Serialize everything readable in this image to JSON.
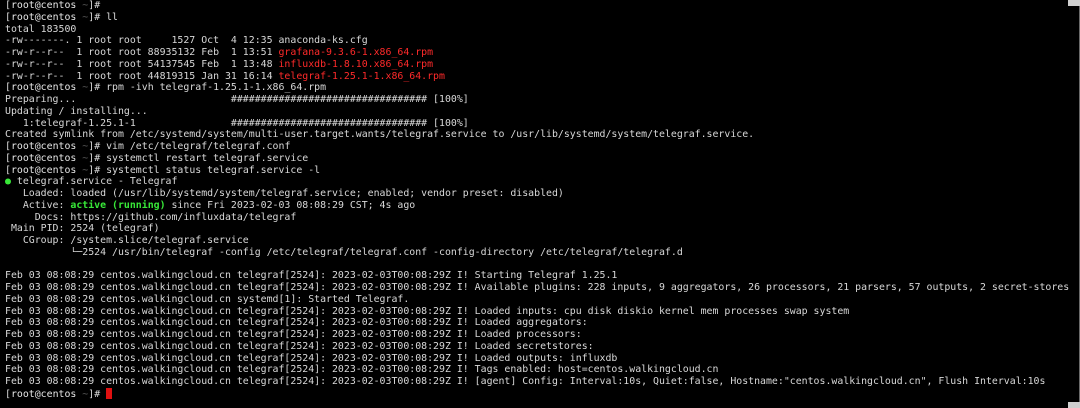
{
  "prompt": {
    "open": "[",
    "user_host": "root@centos",
    "path": " ~",
    "close": "]#"
  },
  "lines": [
    {
      "kind": "prompt",
      "cmd": ""
    },
    {
      "kind": "prompt",
      "cmd": " ll"
    },
    {
      "kind": "text",
      "text": "total 183500"
    },
    {
      "kind": "file",
      "meta": "-rw-------. 1 root root     1527 Oct  4 12:35 ",
      "name": "anaconda-ks.cfg",
      "color": "plain"
    },
    {
      "kind": "file",
      "meta": "-rw-r--r--  1 root root 88935132 Feb  1 13:51 ",
      "name": "grafana-9.3.6-1.x86_64.rpm",
      "color": "red"
    },
    {
      "kind": "file",
      "meta": "-rw-r--r--  1 root root 54137545 Feb  1 13:48 ",
      "name": "influxdb-1.8.10.x86_64.rpm",
      "color": "red"
    },
    {
      "kind": "file",
      "meta": "-rw-r--r--  1 root root 44819315 Jan 31 16:14 ",
      "name": "telegraf-1.25.1-1.x86_64.rpm",
      "color": "red"
    },
    {
      "kind": "prompt",
      "cmd": " rpm -ivh telegraf-1.25.1-1.x86_64.rpm"
    },
    {
      "kind": "text",
      "text": "Preparing...                          ################################# [100%]"
    },
    {
      "kind": "text",
      "text": "Updating / installing..."
    },
    {
      "kind": "text",
      "text": "   1:telegraf-1.25.1-1                ################################# [100%]"
    },
    {
      "kind": "text",
      "text": "Created symlink from /etc/systemd/system/multi-user.target.wants/telegraf.service to /usr/lib/systemd/system/telegraf.service."
    },
    {
      "kind": "prompt",
      "cmd": " vim /etc/telegraf/telegraf.conf"
    },
    {
      "kind": "prompt",
      "cmd": " systemctl restart telegraf.service"
    },
    {
      "kind": "prompt",
      "cmd": " systemctl status telegraf.service -l"
    },
    {
      "kind": "service",
      "bullet": "●",
      "text": " telegraf.service - Telegraf"
    },
    {
      "kind": "text",
      "text": "   Loaded: loaded (/usr/lib/systemd/system/telegraf.service; enabled; vendor preset: disabled)"
    },
    {
      "kind": "active",
      "label": "   Active: ",
      "status": "active (running)",
      "rest": " since Fri 2023-02-03 08:08:29 CST; 4s ago"
    },
    {
      "kind": "text",
      "text": "     Docs: https://github.com/influxdata/telegraf"
    },
    {
      "kind": "text",
      "text": " Main PID: 2524 (telegraf)"
    },
    {
      "kind": "text",
      "text": "   CGroup: /system.slice/telegraf.service"
    },
    {
      "kind": "text",
      "text": "           └─2524 /usr/bin/telegraf -config /etc/telegraf/telegraf.conf -config-directory /etc/telegraf/telegraf.d"
    },
    {
      "kind": "blank"
    },
    {
      "kind": "text",
      "text": "Feb 03 08:08:29 centos.walkingcloud.cn telegraf[2524]: 2023-02-03T00:08:29Z I! Starting Telegraf 1.25.1"
    },
    {
      "kind": "text",
      "text": "Feb 03 08:08:29 centos.walkingcloud.cn telegraf[2524]: 2023-02-03T00:08:29Z I! Available plugins: 228 inputs, 9 aggregators, 26 processors, 21 parsers, 57 outputs, 2 secret-stores"
    },
    {
      "kind": "text",
      "text": "Feb 03 08:08:29 centos.walkingcloud.cn systemd[1]: Started Telegraf."
    },
    {
      "kind": "text",
      "text": "Feb 03 08:08:29 centos.walkingcloud.cn telegraf[2524]: 2023-02-03T00:08:29Z I! Loaded inputs: cpu disk diskio kernel mem processes swap system"
    },
    {
      "kind": "text",
      "text": "Feb 03 08:08:29 centos.walkingcloud.cn telegraf[2524]: 2023-02-03T00:08:29Z I! Loaded aggregators:"
    },
    {
      "kind": "text",
      "text": "Feb 03 08:08:29 centos.walkingcloud.cn telegraf[2524]: 2023-02-03T00:08:29Z I! Loaded processors:"
    },
    {
      "kind": "text",
      "text": "Feb 03 08:08:29 centos.walkingcloud.cn telegraf[2524]: 2023-02-03T00:08:29Z I! Loaded secretstores:"
    },
    {
      "kind": "text",
      "text": "Feb 03 08:08:29 centos.walkingcloud.cn telegraf[2524]: 2023-02-03T00:08:29Z I! Loaded outputs: influxdb"
    },
    {
      "kind": "text",
      "text": "Feb 03 08:08:29 centos.walkingcloud.cn telegraf[2524]: 2023-02-03T00:08:29Z I! Tags enabled: host=centos.walkingcloud.cn"
    },
    {
      "kind": "text",
      "text": "Feb 03 08:08:29 centos.walkingcloud.cn telegraf[2524]: 2023-02-03T00:08:29Z I! [agent] Config: Interval:10s, Quiet:false, Hostname:\"centos.walkingcloud.cn\", Flush Interval:10s"
    },
    {
      "kind": "prompt",
      "cmd": " ",
      "cursor": true
    }
  ],
  "colors": {
    "background": "#000000",
    "text": "#d8d8d8",
    "rpm_file": "#ff2a2a",
    "active_status": "#38e838",
    "cursor": "#e01010",
    "prompt_path": "#5a5a5a"
  }
}
